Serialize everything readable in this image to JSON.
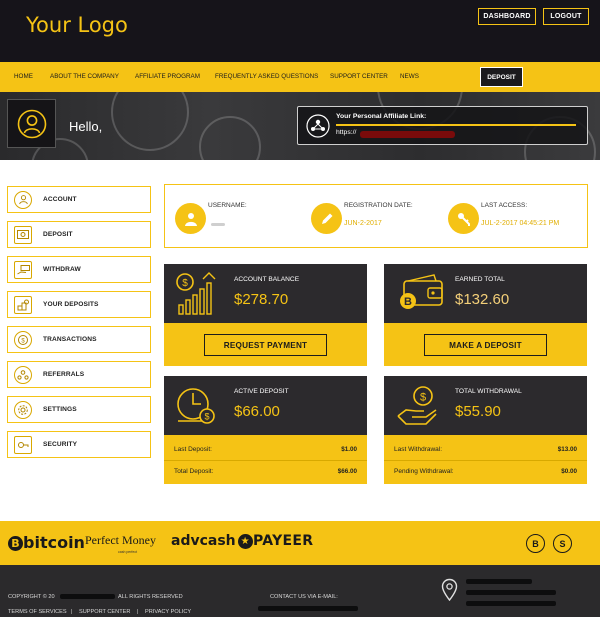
{
  "header": {
    "logo": "Your Logo",
    "dashboard_btn": "DASHBOARD",
    "logout_btn": "LOGOUT"
  },
  "nav": {
    "items": [
      "HOME",
      "ABOUT THE COMPANY",
      "AFFILIATE PROGRAM",
      "FREQUENTLY ASKED QUESTIONS",
      "SUPPORT CENTER",
      "NEWS"
    ],
    "deposit": "DEPOSIT"
  },
  "hero": {
    "greeting": "Hello,",
    "affiliate_title": "Your Personal Affiliate Link:",
    "affiliate_url": "https://"
  },
  "sidebar": {
    "items": [
      {
        "label": "ACCOUNT",
        "icon": "user-icon"
      },
      {
        "label": "DEPOSIT",
        "icon": "cash-icon"
      },
      {
        "label": "WITHDRAW",
        "icon": "hand-cash-icon"
      },
      {
        "label": "YOUR DEPOSITS",
        "icon": "coins-icon"
      },
      {
        "label": "TRANSACTIONS",
        "icon": "coin-icon"
      },
      {
        "label": "REFERRALS",
        "icon": "referrals-icon"
      },
      {
        "label": "SETTINGS",
        "icon": "gear-icon"
      },
      {
        "label": "SECURITY",
        "icon": "security-icon"
      }
    ]
  },
  "info": {
    "username_label": "USERNAME:",
    "username_value": "",
    "reg_label": "REGISTRATION DATE:",
    "reg_value": "JUN-2-2017",
    "access_label": "LAST ACCESS:",
    "access_value": "JUL-2-2017 04:45:21 PM"
  },
  "cards": {
    "balance": {
      "label": "ACCOUNT BALANCE",
      "amount": "$278.70",
      "button": "REQUEST PAYMENT"
    },
    "earned": {
      "label": "EARNED TOTAL",
      "amount": "$132.60",
      "button": "MAKE A DEPOSIT"
    },
    "active": {
      "label": "ACTIVE DEPOSIT",
      "amount": "$66.00",
      "row1_label": "Last Deposit:",
      "row1_value": "$1.00",
      "row2_label": "Total Deposit:",
      "row2_value": "$66.00"
    },
    "withdrawal": {
      "label": "TOTAL WITHDRAWAL",
      "amount": "$55.90",
      "row1_label": "Last Withdrawal:",
      "row1_value": "$13.00",
      "row2_label": "Pending Withdrawal:",
      "row2_value": "$0.00"
    }
  },
  "payments": {
    "bitcoin": "bitcoin",
    "perfect_money": "Perfect Money",
    "perfect_money_sub": "cash perfect",
    "advcash": "advcash",
    "payeer": "PAYEER",
    "icons": [
      "bitcoin-circle-icon",
      "skrill-icon"
    ]
  },
  "footer": {
    "copyright_prefix": "COPYRIGHT © 20",
    "rights": "ALL RIGHTS RESERVED",
    "contact": "CONTACT US VIA E-MAIL:",
    "terms": "TERMS OF SERVICES",
    "support": "SUPPORT CENTER",
    "privacy": "PRIVACY POLICY"
  },
  "colors": {
    "accent": "#f5c315",
    "dark": "#16141a",
    "card_dark": "#2c2a2d"
  }
}
